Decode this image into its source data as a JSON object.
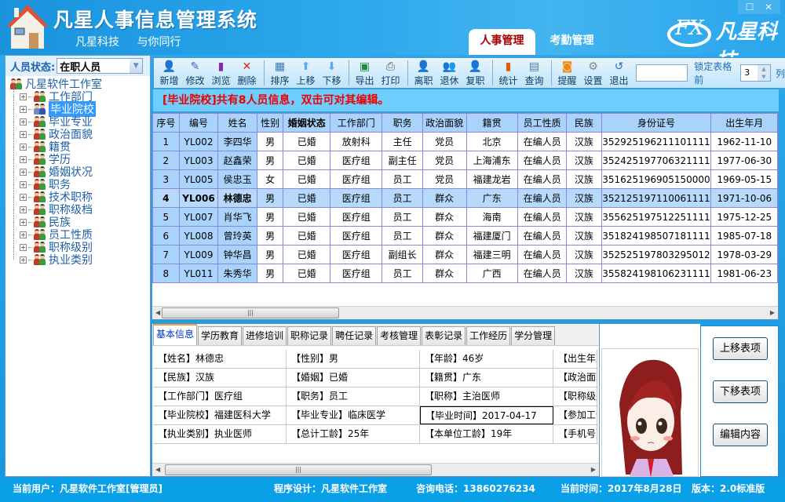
{
  "header": {
    "title": "凡星人事信息管理系统",
    "slogan": [
      "凡星科技",
      "与你同行"
    ],
    "brand": "凡星科技",
    "brand_logo_text": "FX",
    "tabs": [
      {
        "label": "人事管理",
        "active": true
      },
      {
        "label": "考勤管理",
        "active": false
      }
    ],
    "window_controls": [
      "maximize-icon",
      "close-icon"
    ]
  },
  "sidebar": {
    "status_label": "人员状态:",
    "status_value": "在职人员",
    "root": "凡星软件工作室",
    "items": [
      {
        "label": "工作部门"
      },
      {
        "label": "毕业院校",
        "selected": true
      },
      {
        "label": "毕业专业"
      },
      {
        "label": "政治面貌"
      },
      {
        "label": "籍贯"
      },
      {
        "label": "学历"
      },
      {
        "label": "婚姻状况"
      },
      {
        "label": "职务"
      },
      {
        "label": "技术职称"
      },
      {
        "label": "职称级档"
      },
      {
        "label": "民族"
      },
      {
        "label": "员工性质"
      },
      {
        "label": "职称级别"
      },
      {
        "label": "执业类别"
      }
    ]
  },
  "toolbar": {
    "groups": [
      [
        {
          "label": "新增",
          "icon": "add-user-icon"
        },
        {
          "label": "修改",
          "icon": "edit-icon"
        },
        {
          "label": "浏览",
          "icon": "browse-chart-icon"
        },
        {
          "label": "删除",
          "icon": "delete-icon"
        }
      ],
      [
        {
          "label": "排序",
          "icon": "sort-grid-icon"
        },
        {
          "label": "上移",
          "icon": "arrow-up-icon"
        },
        {
          "label": "下移",
          "icon": "arrow-down-icon"
        }
      ],
      [
        {
          "label": "导出",
          "icon": "excel-icon"
        },
        {
          "label": "打印",
          "icon": "printer-icon"
        }
      ],
      [
        {
          "label": "离职",
          "icon": "resign-icon"
        },
        {
          "label": "退休",
          "icon": "retire-icon"
        },
        {
          "label": "复职",
          "icon": "reinstate-icon"
        }
      ],
      [
        {
          "label": "统计",
          "icon": "statistics-icon"
        },
        {
          "label": "查询",
          "icon": "query-icon"
        }
      ],
      [
        {
          "label": "提醒",
          "icon": "rss-icon"
        },
        {
          "label": "设置",
          "icon": "gear-icon"
        },
        {
          "label": "退出",
          "icon": "exit-icon"
        }
      ]
    ],
    "search_value": "",
    "lock_label": "锁定表格前",
    "lock_value": "3",
    "lock_unit": "列"
  },
  "info_message": "[毕业院校]共有8人员信息，双击可对其编辑。",
  "grid": {
    "columns": [
      "序号",
      "编号",
      "姓名",
      "性别",
      "婚姻状态",
      "工作部门",
      "职务",
      "政治面貌",
      "籍贯",
      "员工性质",
      "民族",
      "身份证号",
      "出生年月"
    ],
    "rows": [
      [
        "1",
        "YL002",
        "李四华",
        "男",
        "已婚",
        "放射科",
        "主任",
        "党员",
        "北京",
        "在编人员",
        "汉族",
        "352925196211101111",
        "1962-11-10"
      ],
      [
        "2",
        "YL003",
        "赵鑫荣",
        "男",
        "已婚",
        "医疗组",
        "副主任",
        "党员",
        "上海浦东",
        "在编人员",
        "汉族",
        "352425197706321111",
        "1977-06-30"
      ],
      [
        "3",
        "YL005",
        "侯忠玉",
        "女",
        "已婚",
        "医疗组",
        "员工",
        "党员",
        "福建龙岩",
        "在编人员",
        "汉族",
        "351625196905150000",
        "1969-05-15"
      ],
      [
        "4",
        "YL006",
        "林德忠",
        "男",
        "已婚",
        "医疗组",
        "员工",
        "群众",
        "广东",
        "在编人员",
        "汉族",
        "352125197110061111",
        "1971-10-06"
      ],
      [
        "5",
        "YL007",
        "肖华飞",
        "男",
        "已婚",
        "医疗组",
        "员工",
        "群众",
        "海南",
        "在编人员",
        "汉族",
        "355625197512251111",
        "1975-12-25"
      ],
      [
        "6",
        "YL008",
        "曾玲英",
        "男",
        "已婚",
        "医疗组",
        "员工",
        "群众",
        "福建厦门",
        "在编人员",
        "汉族",
        "351824198507181111",
        "1985-07-18"
      ],
      [
        "7",
        "YL009",
        "钟华昌",
        "男",
        "已婚",
        "医疗组",
        "副组长",
        "群众",
        "福建三明",
        "在编人员",
        "汉族",
        "352525197803295012",
        "1978-03-29"
      ],
      [
        "8",
        "YL011",
        "朱秀华",
        "男",
        "已婚",
        "医疗组",
        "员工",
        "群众",
        "广西",
        "在编人员",
        "汉族",
        "355824198106231111",
        "1981-06-23"
      ]
    ],
    "selected_row": 4
  },
  "detail": {
    "tabs": [
      "基本信息",
      "学历教育",
      "进修培训",
      "职称记录",
      "聘任记录",
      "考核管理",
      "表彰记录",
      "工作经历",
      "学分管理"
    ],
    "active_tab": "基本信息",
    "fields": [
      [
        "【姓名】林德忠",
        "【性别】男",
        "【年龄】46岁",
        "【出生年月"
      ],
      [
        "【民族】汉族",
        "【婚姻】已婚",
        "【籍贯】广东",
        "【政治面貌"
      ],
      [
        "【工作部门】医疗组",
        "【职务】员工",
        "【职称】主治医师",
        "【职称级别"
      ],
      [
        "【毕业院校】福建医科大学",
        "【毕业专业】临床医学",
        "【毕业时间】2017-04-17",
        "【参加工作"
      ],
      [
        "【执业类别】执业医师",
        "【总计工龄】25年",
        "【本单位工龄】19年",
        "【手机号】"
      ]
    ]
  },
  "side_buttons": [
    "上移表项",
    "下移表项",
    "编辑内容"
  ],
  "statusbar": {
    "user": "当前用户：凡星软件工作室[管理员]",
    "designer": "程序设计：凡星软件工作室",
    "phone": "咨询电话：13860276234",
    "time": "当前时间：2017年8月28日",
    "version": "版本：2.0标准版"
  }
}
